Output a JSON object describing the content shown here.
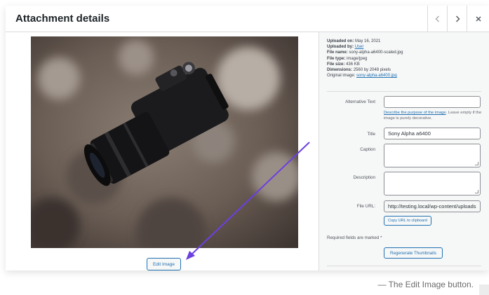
{
  "modal": {
    "title": "Attachment details"
  },
  "meta": {
    "uploaded_on_label": "Uploaded on:",
    "uploaded_on": "May 16, 2021",
    "uploaded_by_label": "Uploaded by:",
    "uploaded_by": "User",
    "file_name_label": "File name:",
    "file_name": "sony-alpha-a6400-scaled.jpg",
    "file_type_label": "File type:",
    "file_type": "image/jpeg",
    "file_size_label": "File size:",
    "file_size": "436 KB",
    "dimensions_label": "Dimensions:",
    "dimensions": "2560 by 2048 pixels",
    "original_label": "Original image:",
    "original": "sony-alpha-a6400.jpg"
  },
  "form": {
    "alt_label": "Alternative Text",
    "alt_value": "",
    "alt_hint_link": "Describe the purpose of the image",
    "alt_hint_rest": ". Leave empty if the image is purely decorative.",
    "title_label": "Title",
    "title_value": "Sony Alpha a6400",
    "caption_label": "Caption",
    "caption_value": "",
    "description_label": "Description",
    "description_value": "",
    "file_url_label": "File URL:",
    "file_url_value": "http://testing.local/wp-content/uploads",
    "copy_url_label": "Copy URL to clipboard",
    "required_text": "Required fields are marked *",
    "regenerate_label": "Regenerate Thumbnails"
  },
  "preview": {
    "edit_image_label": "Edit Image"
  },
  "caption_text": "— The Edit Image button.",
  "colors": {
    "accent": "#2271b1",
    "arrow": "#6c3fe0"
  }
}
